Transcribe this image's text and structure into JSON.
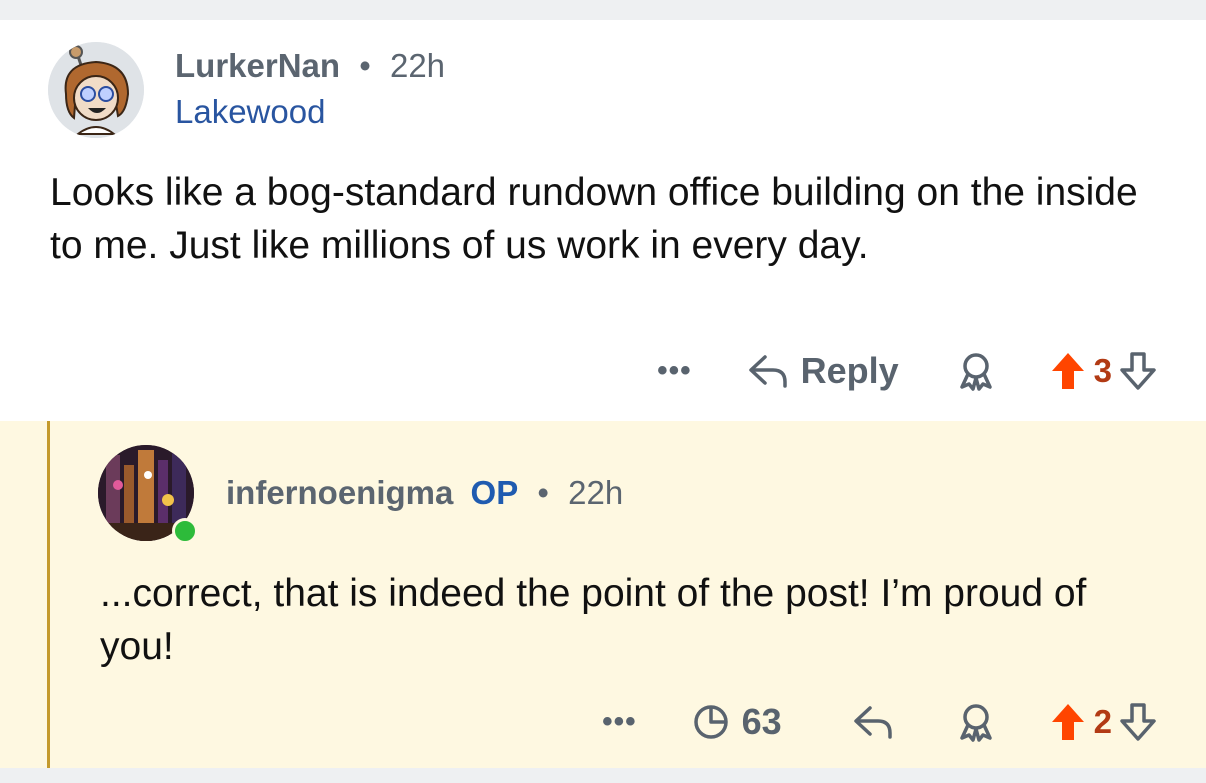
{
  "comments": [
    {
      "username": "LurkerNan",
      "separator": "•",
      "time": "22h",
      "flair": "Lakewood",
      "body": "Looks like a bog-standard rundown office building on the inside to me. Just like millions of us work in every day.",
      "actions": {
        "more": "•••",
        "reply": "Reply",
        "score": "3"
      }
    },
    {
      "username": "infernoenigma",
      "op_badge": "OP",
      "separator": "•",
      "time": "22h",
      "body": "...correct, that is indeed the point of the post! I’m proud of you!",
      "actions": {
        "more": "•••",
        "views": "63",
        "score": "2"
      }
    }
  ],
  "colors": {
    "upvote_active": "#ff4500",
    "score": "#b23a14",
    "flair": "#2955a0",
    "op_badge": "#1f5bb0",
    "reply_bg": "#fef8e1",
    "thread_line": "#c49a2c",
    "online": "#2dbb3a"
  },
  "icons": [
    "avatar",
    "more-icon",
    "reply-arrow-icon",
    "award-icon",
    "upvote-icon",
    "downvote-icon",
    "views-icon",
    "online-indicator"
  ]
}
